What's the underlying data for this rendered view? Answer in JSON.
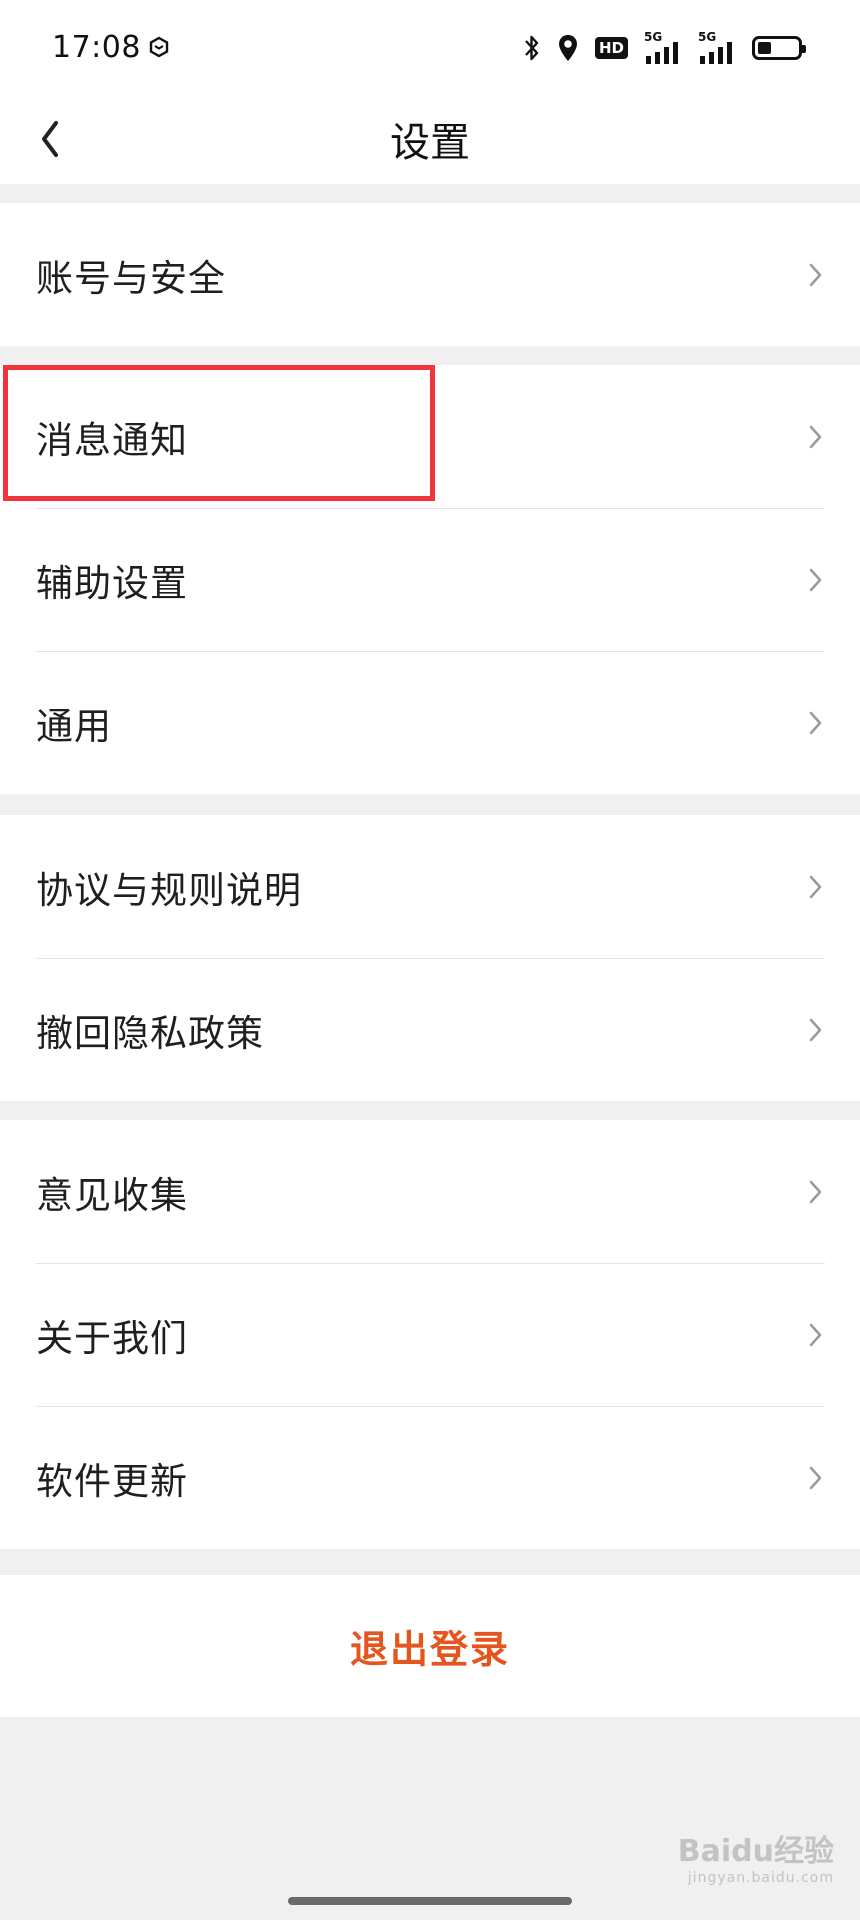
{
  "status_bar": {
    "time": "17:08",
    "hd_label": "HD",
    "signal_1_label": "5G",
    "signal_2_label": "5G",
    "battery_level": 0.35
  },
  "nav": {
    "title": "设置"
  },
  "groups": [
    {
      "items": [
        "账号与安全"
      ]
    },
    {
      "items": [
        "消息通知",
        "辅助设置",
        "通用"
      ]
    },
    {
      "items": [
        "协议与规则说明",
        "撤回隐私政策"
      ]
    },
    {
      "items": [
        "意见收集",
        "关于我们",
        "软件更新"
      ]
    }
  ],
  "logout": {
    "label": "退出登录"
  },
  "watermark": {
    "main": "Baidu经验",
    "sub": "jingyan.baidu.com"
  },
  "colors": {
    "accent": "#e5561f",
    "highlight": "#f0353d",
    "background": "#f0f0f0"
  }
}
